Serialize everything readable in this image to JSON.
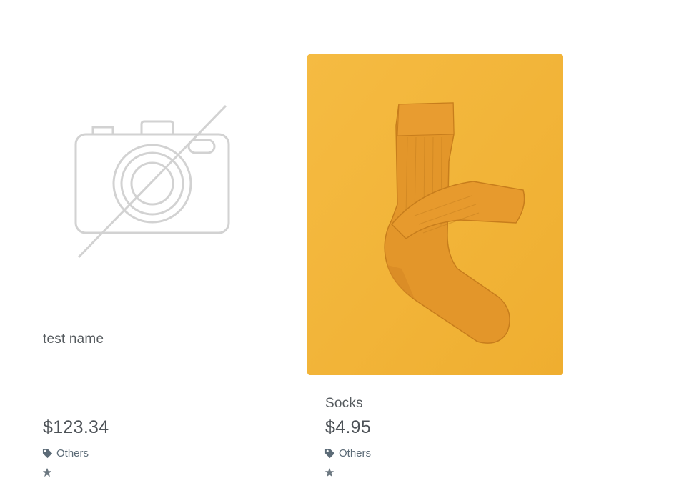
{
  "products": [
    {
      "name": "test name",
      "price": "$123.34",
      "category": "Others",
      "image": "no-image-placeholder",
      "icons": {
        "category": "tag-icon",
        "rating": "star-icon"
      }
    },
    {
      "name": "Socks",
      "price": "$4.95",
      "category": "Others",
      "image": "orange-socks-photo",
      "icons": {
        "category": "tag-icon",
        "rating": "star-icon"
      }
    }
  ],
  "colors": {
    "photo_background": "#f3b63a",
    "sock": "#e3962a",
    "text": "#4d5257",
    "meta": "#5c6b77"
  }
}
